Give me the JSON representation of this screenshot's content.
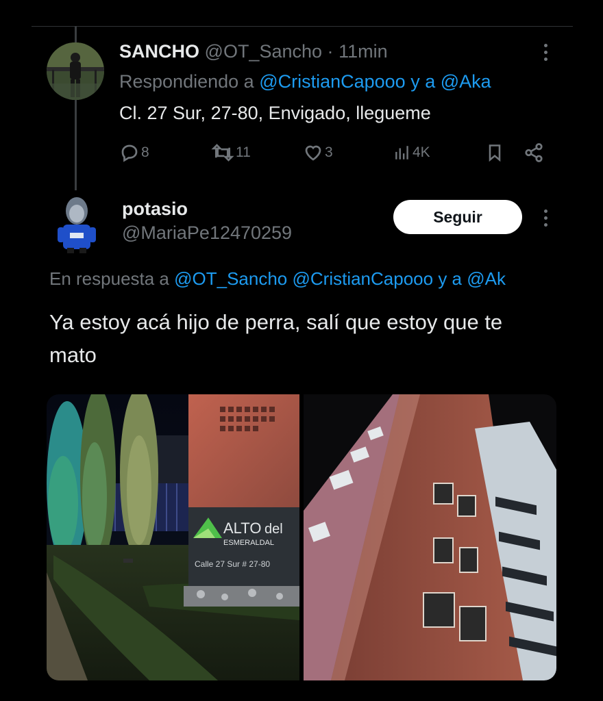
{
  "tweet1": {
    "display_name": "SANCHO",
    "handle": "@OT_Sancho",
    "separator": "·",
    "time": "11min",
    "reply_prefix": "Respondiendo a",
    "reply_mentions": "@CristianCapooo y a @Aka",
    "text": "Cl. 27 Sur, 27-80, Envigado, llegueme",
    "replies": "8",
    "retweets": "11",
    "likes": "3",
    "views": "4K"
  },
  "tweet2": {
    "display_name": "potasio",
    "handle": "@MariaPe12470259",
    "follow_label": "Seguir",
    "reply_prefix": "En respuesta a",
    "reply_mentions": "@OT_Sancho @CristianCapooo y a @Ak",
    "text": "Ya estoy acá hijo de perra, salí que estoy que te mato",
    "photo1_sign": {
      "line1": "ALTO",
      "line1b": "del",
      "line2": "ESMERALDAL",
      "line3": "Calle 27 Sur # 27-80"
    }
  },
  "colors": {
    "background": "#000000",
    "text": "#e7e9ea",
    "muted": "#71767b",
    "link": "#1d9bf0",
    "button_bg": "#ffffff"
  },
  "icons": [
    "reply-icon",
    "retweet-icon",
    "like-icon",
    "views-icon",
    "bookmark-icon",
    "share-icon",
    "more-icon"
  ]
}
